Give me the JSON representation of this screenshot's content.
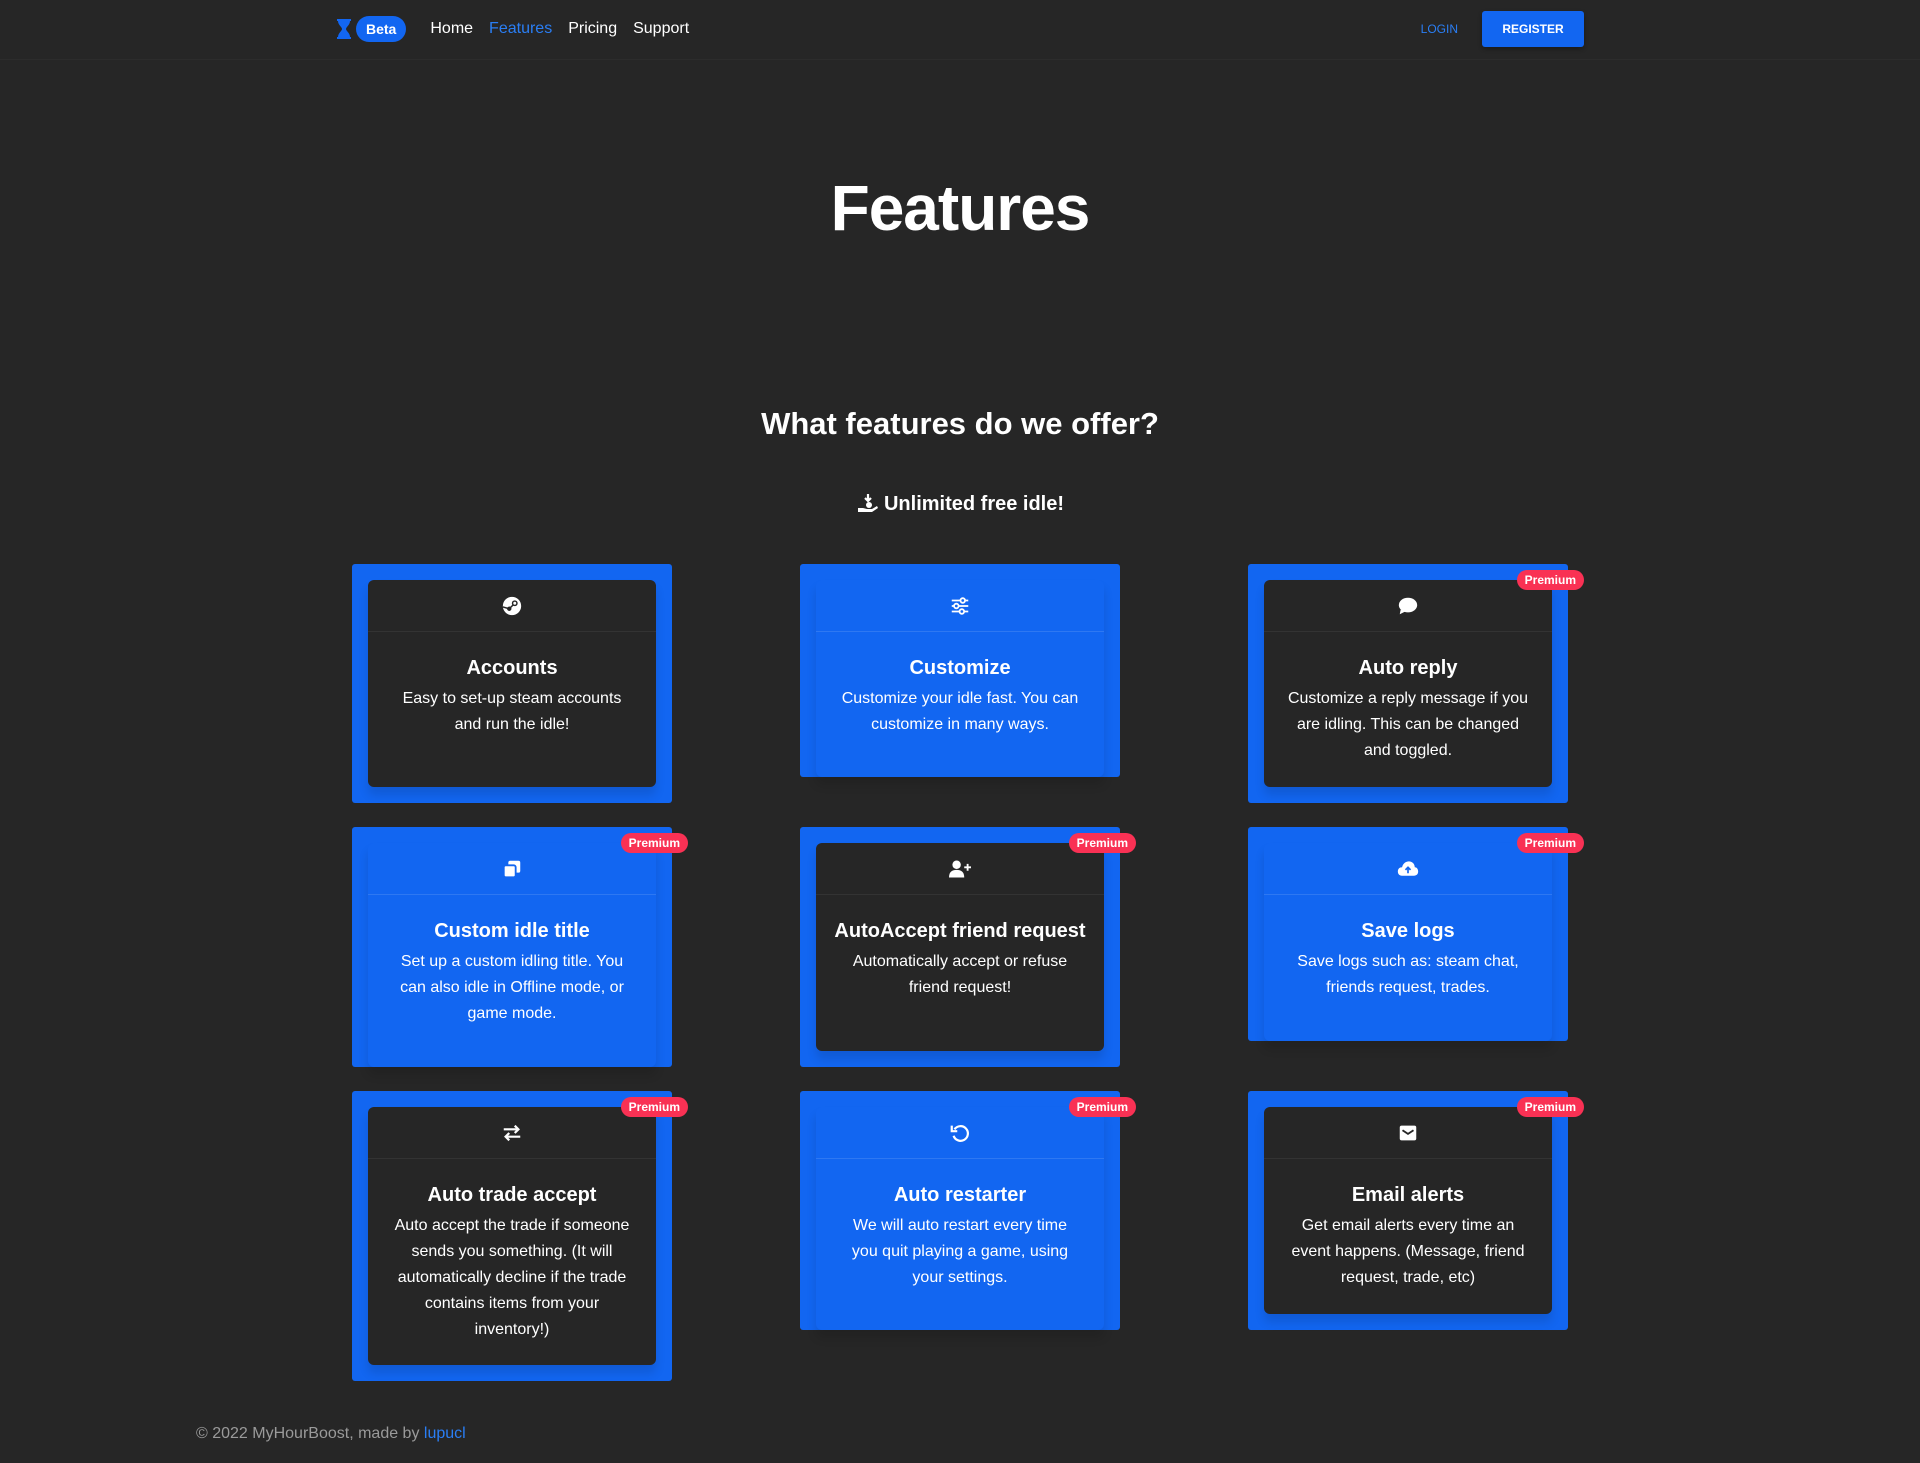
{
  "nav": {
    "beta_label": "Beta",
    "links": [
      {
        "label": "Home",
        "active": false
      },
      {
        "label": "Features",
        "active": true
      },
      {
        "label": "Pricing",
        "active": false
      },
      {
        "label": "Support",
        "active": false
      }
    ],
    "login_label": "LOGIN",
    "register_label": "REGISTER"
  },
  "hero": {
    "title": "Features"
  },
  "section": {
    "title": "What features do we offer?",
    "free_text": "Unlimited free idle!"
  },
  "premium_label": "Premium",
  "cards": [
    {
      "title": "Accounts",
      "text": "Easy to set-up steam accounts and run the idle!",
      "icon": "steam-icon",
      "premium": false,
      "dark": true
    },
    {
      "title": "Customize",
      "text": "Customize your idle fast. You can customize in many ways.",
      "icon": "sliders-icon",
      "premium": false,
      "dark": false
    },
    {
      "title": "Auto reply",
      "text": "Customize a reply message if you are idling. This can be changed and toggled.",
      "icon": "comment-icon",
      "premium": true,
      "dark": true
    },
    {
      "title": "Custom idle title",
      "text": "Set up a custom idling title. You can also idle in Offline mode, or game mode.",
      "icon": "clone-icon",
      "premium": true,
      "dark": false
    },
    {
      "title": "AutoAccept friend request",
      "text": "Automatically accept or refuse friend request!",
      "icon": "user-plus-icon",
      "premium": true,
      "dark": true
    },
    {
      "title": "Save logs",
      "text": "Save logs such as: steam chat, friends request, trades.",
      "icon": "cloud-upload-icon",
      "premium": true,
      "dark": false
    },
    {
      "title": "Auto trade accept",
      "text": "Auto accept the trade if someone sends you something. (It will automatically decline if the trade contains items from your inventory!)",
      "icon": "exchange-icon",
      "premium": true,
      "dark": true
    },
    {
      "title": "Auto restarter",
      "text": "We will auto restart every time you quit playing a game, using your settings.",
      "icon": "undo-icon",
      "premium": true,
      "dark": false
    },
    {
      "title": "Email alerts",
      "text": "Get email alerts every time an event happens. (Message, friend request, trade, etc)",
      "icon": "envelope-icon",
      "premium": true,
      "dark": true
    }
  ],
  "footer": {
    "text": "© 2022 MyHourBoost, made by",
    "author": "lupucl"
  },
  "colors": {
    "background": "#262626",
    "primary": "#1266f1",
    "link": "#2a7ef4",
    "premium": "#f93154"
  }
}
